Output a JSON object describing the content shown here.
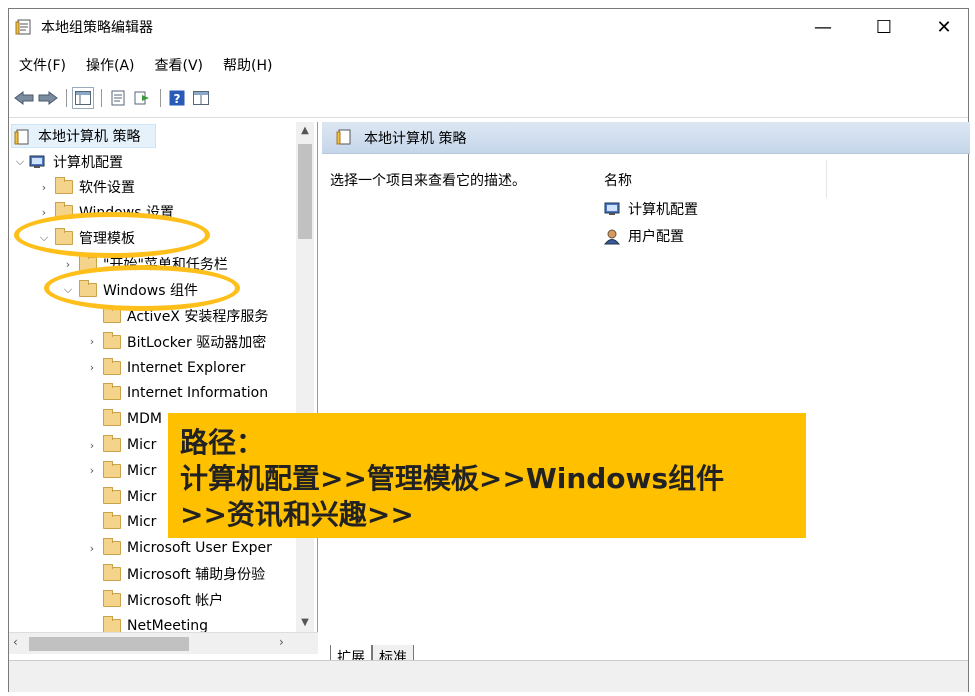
{
  "window": {
    "title": "本地组策略编辑器",
    "minimize": "—",
    "maximize": "☐",
    "close": "✕"
  },
  "menubar": {
    "file": "文件(F)",
    "action": "操作(A)",
    "view": "查看(V)",
    "help": "帮助(H)"
  },
  "tree": {
    "root": "本地计算机 策略",
    "computer_config": "计算机配置",
    "software_settings": "软件设置",
    "windows_settings": "Windows 设置",
    "admin_templates": "管理模板",
    "start_menu": "\"开始\"菜单和任务栏",
    "windows_components": "Windows 组件",
    "items": [
      {
        "label": "ActiveX 安装程序服务",
        "expandable": false
      },
      {
        "label": "BitLocker 驱动器加密",
        "expandable": true
      },
      {
        "label": "Internet Explorer",
        "expandable": true
      },
      {
        "label": "Internet Information",
        "expandable": false
      },
      {
        "label": "MDM",
        "expandable": false
      },
      {
        "label": "Micr",
        "expandable": true
      },
      {
        "label": "Micr",
        "expandable": true
      },
      {
        "label": "Micr",
        "expandable": false
      },
      {
        "label": "Micr",
        "expandable": false
      },
      {
        "label": "Microsoft User Exper",
        "expandable": true
      },
      {
        "label": "Microsoft 辅助身份验",
        "expandable": false
      },
      {
        "label": "Microsoft 帐户",
        "expandable": false
      },
      {
        "label": "NetMeeting",
        "expandable": false
      }
    ]
  },
  "right": {
    "header": "本地计算机 策略",
    "description": "选择一个项目来查看它的描述。",
    "column_name": "名称",
    "list": [
      "计算机配置",
      "用户配置"
    ],
    "tab_extended": "扩展",
    "tab_standard": "标准"
  },
  "callout": {
    "line1": "路径：",
    "line2": "计算机配置>>管理模板>>Windows组件",
    "line3": ">>资讯和兴趣>>"
  },
  "colors": {
    "highlight": "#ffc000",
    "ellipse": "#ffbf1a"
  }
}
